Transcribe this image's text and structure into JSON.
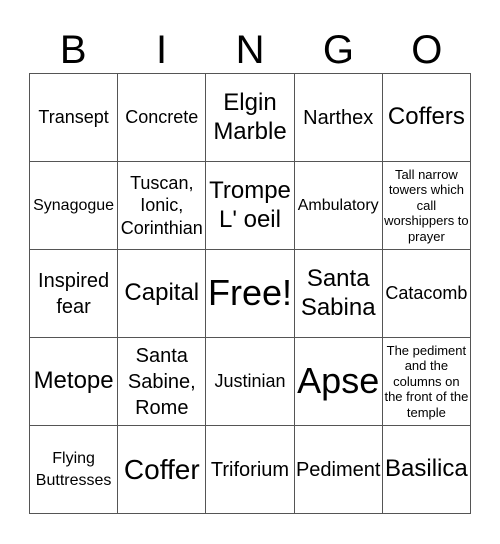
{
  "header": [
    "B",
    "I",
    "N",
    "G",
    "O"
  ],
  "cells": [
    [
      "Transept",
      "Concrete",
      "Elgin Marble",
      "Narthex",
      "Coffers"
    ],
    [
      "Synagogue",
      "Tuscan, Ionic, Corinthian",
      "Trompe L' oeil",
      "Ambulatory",
      "Tall narrow towers which call worshippers to prayer"
    ],
    [
      "Inspired fear",
      "Capital",
      "Free!",
      "Santa Sabina",
      "Catacomb"
    ],
    [
      "Metope",
      "Santa Sabine, Rome",
      "Justinian",
      "Apse",
      "The pediment and the columns on the front of the temple"
    ],
    [
      "Flying Buttresses",
      "Coffer",
      "Triforium",
      "Pediment",
      "Basilica"
    ]
  ]
}
